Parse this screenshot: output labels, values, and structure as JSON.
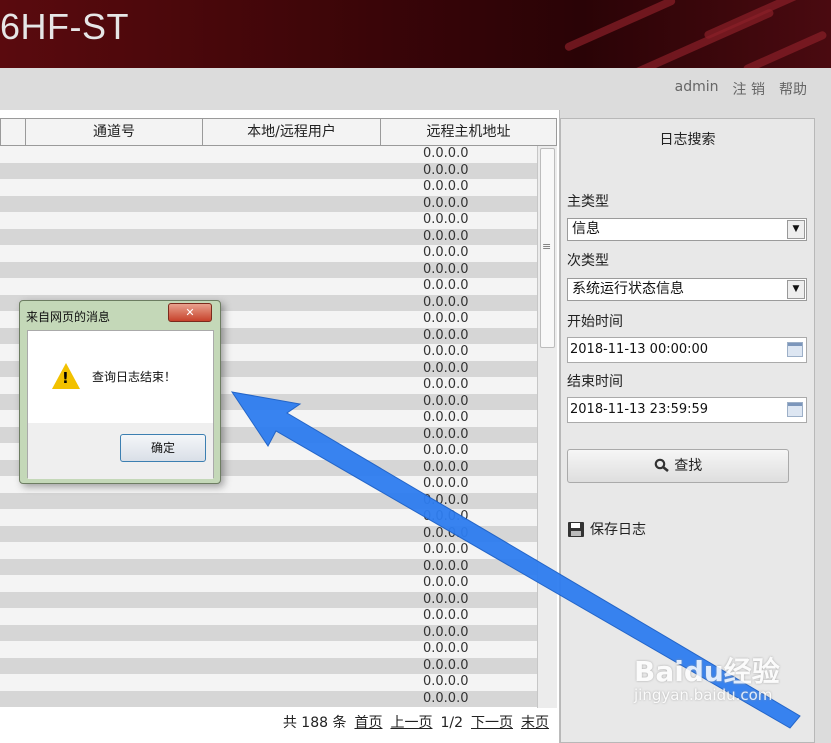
{
  "header": {
    "brand_title": "6HF-ST"
  },
  "topbar": {
    "user": "admin",
    "logout": "注 销",
    "help": "帮助"
  },
  "table": {
    "columns": [
      "通道号",
      "本地/远程用户",
      "远程主机地址"
    ],
    "rows": [
      "0.0.0.0",
      "0.0.0.0",
      "0.0.0.0",
      "0.0.0.0",
      "0.0.0.0",
      "0.0.0.0",
      "0.0.0.0",
      "0.0.0.0",
      "0.0.0.0",
      "0.0.0.0",
      "0.0.0.0",
      "0.0.0.0",
      "0.0.0.0",
      "0.0.0.0",
      "0.0.0.0",
      "0.0.0.0",
      "0.0.0.0",
      "0.0.0.0",
      "0.0.0.0",
      "0.0.0.0",
      "0.0.0.0",
      "0.0.0.0",
      "0.0.0.0",
      "0.0.0.0",
      "0.0.0.0",
      "0.0.0.0",
      "0.0.0.0",
      "0.0.0.0",
      "0.0.0.0",
      "0.0.0.0",
      "0.0.0.0",
      "0.0.0.0",
      "0.0.0.0",
      "0.0.0.0"
    ]
  },
  "pager": {
    "total": "共 188 条",
    "first": "首页",
    "prev": "上一页",
    "page": "1/2",
    "next": "下一页",
    "last": "末页"
  },
  "sidebar": {
    "title": "日志搜索",
    "main_type_label": "主类型",
    "main_type_value": "信息",
    "sub_type_label": "次类型",
    "sub_type_value": "系统运行状态信息",
    "start_label": "开始时间",
    "start_value": "2018-11-13 00:00:00",
    "end_label": "结束时间",
    "end_value": "2018-11-13 23:59:59",
    "search_label": "查找",
    "save_label": "保存日志"
  },
  "dialog": {
    "title": "来自网页的消息",
    "message": "查询日志结束！",
    "ok_label": "确定"
  },
  "watermark": {
    "brand": "Baidu经验",
    "url": "jingyan.baidu.com"
  },
  "colors": {
    "header_bg": "#3a0508",
    "arrow": "#2e7df0",
    "dialog_frame": "#c4d8b8"
  }
}
